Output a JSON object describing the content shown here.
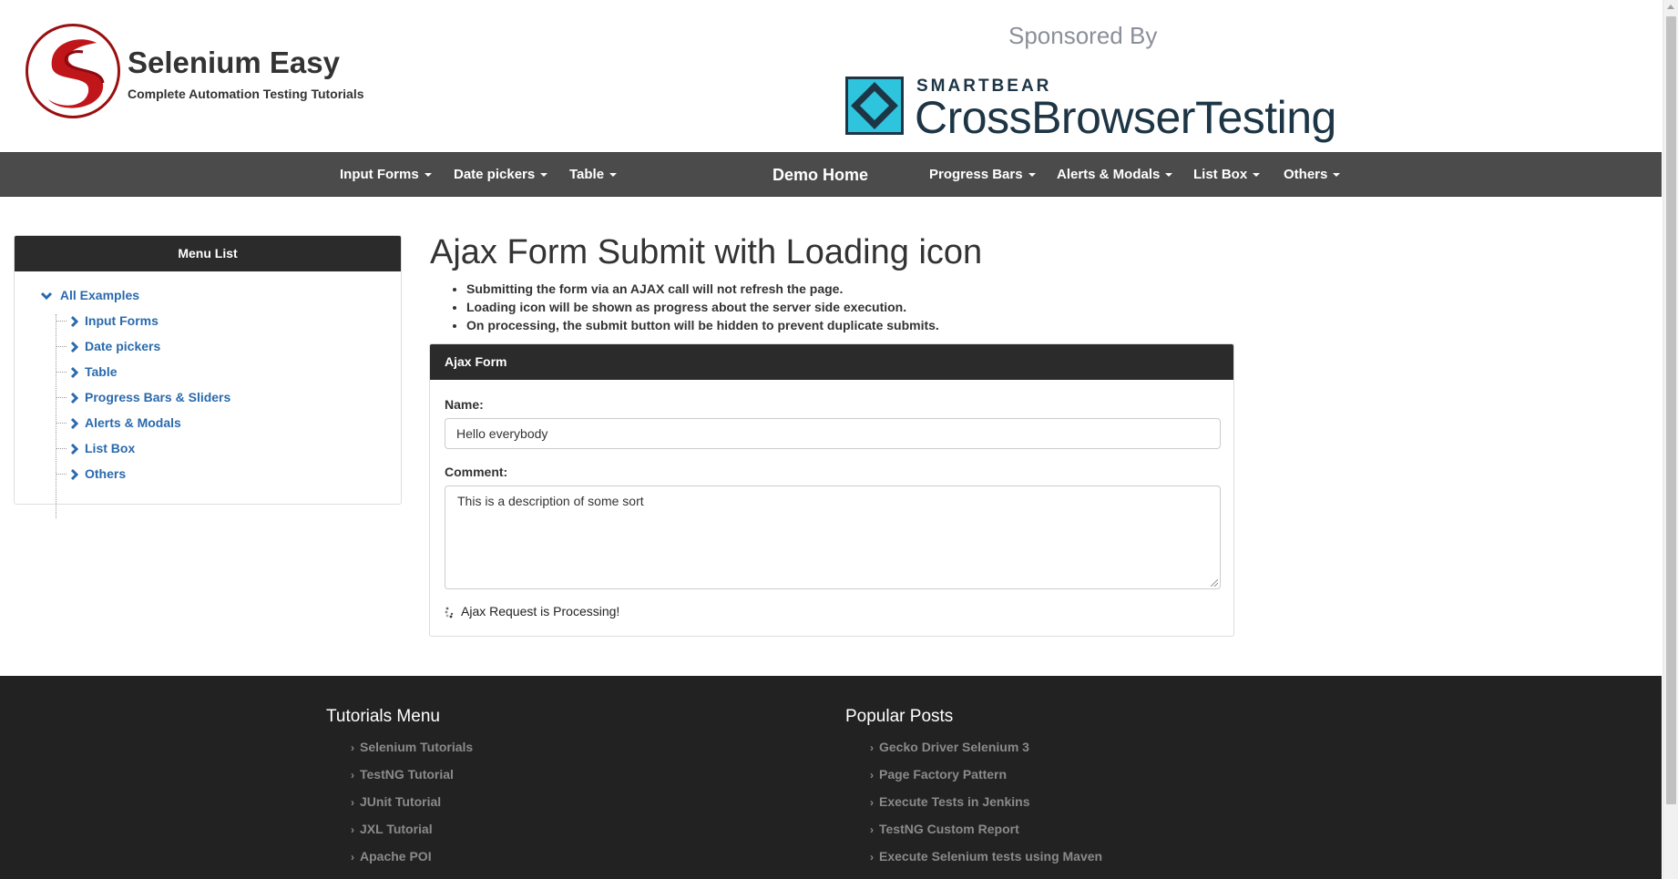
{
  "header": {
    "brand_title": "Selenium Easy",
    "brand_subtitle": "Complete Automation Testing Tutorials",
    "sponsor_label": "Sponsored By",
    "sponsor_company": "SMARTBEAR",
    "sponsor_product": "CrossBrowserTesting"
  },
  "navbar": {
    "items": [
      {
        "label": "Input Forms"
      },
      {
        "label": "Date pickers"
      },
      {
        "label": "Table"
      },
      {
        "label": "Demo Home"
      },
      {
        "label": "Progress Bars"
      },
      {
        "label": "Alerts & Modals"
      },
      {
        "label": "List Box"
      },
      {
        "label": "Others"
      }
    ]
  },
  "sidebar": {
    "title": "Menu List",
    "root": "All Examples",
    "items": [
      {
        "label": "Input Forms"
      },
      {
        "label": "Date pickers"
      },
      {
        "label": "Table"
      },
      {
        "label": "Progress Bars & Sliders"
      },
      {
        "label": "Alerts & Modals"
      },
      {
        "label": "List Box"
      },
      {
        "label": "Others"
      }
    ]
  },
  "main": {
    "title": "Ajax Form Submit with Loading icon",
    "bullets": [
      "Submitting the form via an AJAX call will not refresh the page.",
      "Loading icon will be shown as progress about the server side execution.",
      "On processing, the submit button will be hidden to prevent duplicate submits."
    ],
    "form": {
      "heading": "Ajax Form",
      "name_label": "Name:",
      "name_value": "Hello everybody",
      "comment_label": "Comment:",
      "comment_value": "This is a description of some sort",
      "status_text": "Ajax Request is Processing!"
    }
  },
  "footer": {
    "tutorials_title": "Tutorials Menu",
    "tutorials": [
      "Selenium Tutorials",
      "TestNG Tutorial",
      "JUnit Tutorial",
      "JXL Tutorial",
      "Apache POI"
    ],
    "popular_title": "Popular Posts",
    "popular": [
      "Gecko Driver Selenium 3",
      "Page Factory Pattern",
      "Execute Tests in Jenkins",
      "TestNG Custom Report",
      "Execute Selenium tests using Maven"
    ]
  },
  "colors": {
    "navbar_bg": "#4b4b4b",
    "panel_head_bg": "#2b2b2b",
    "link_blue": "#2a6aad",
    "footer_bg": "#222222",
    "brand_red": "#9a0f10",
    "cbt_cyan": "#2ec4dd"
  },
  "icons": {
    "caret": "caret-down-icon",
    "tree_expand": "chevron-down-icon",
    "tree_item": "chevron-right-icon",
    "loading": "spinner-icon",
    "footer_bullet": "angle-right-icon"
  }
}
